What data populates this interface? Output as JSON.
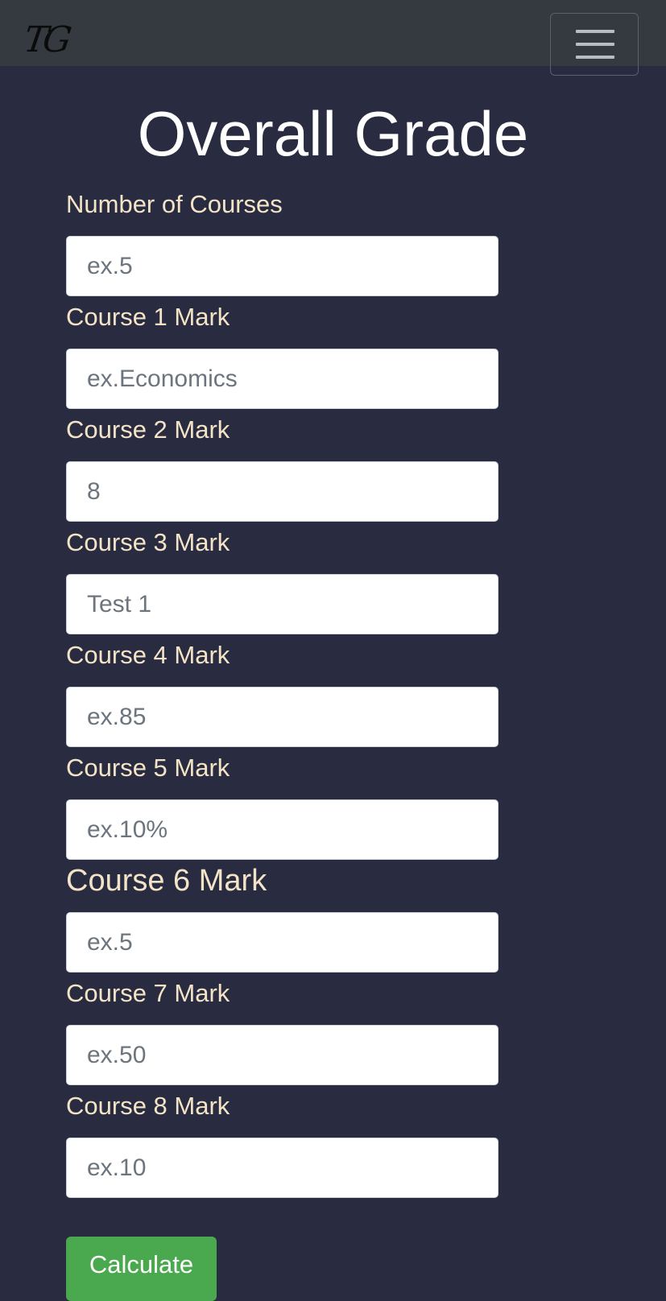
{
  "navbar": {
    "brand": "TG",
    "toggle_icon": "hamburger-menu-icon"
  },
  "page": {
    "title": "Overall Grade"
  },
  "form": {
    "fields": [
      {
        "label": "Number of Courses",
        "placeholder": "ex.5",
        "value": ""
      },
      {
        "label": "Course 1 Mark",
        "placeholder": "ex.Economics",
        "value": ""
      },
      {
        "label": "Course 2 Mark",
        "placeholder": "",
        "value": "8"
      },
      {
        "label": "Course 3 Mark",
        "placeholder": "Test 1",
        "value": ""
      },
      {
        "label": "Course 4 Mark",
        "placeholder": "ex.85",
        "value": ""
      },
      {
        "label": "Course 5 Mark",
        "placeholder": "ex.10%",
        "value": ""
      },
      {
        "label": "Course 6 Mark",
        "placeholder": "ex.5",
        "value": ""
      },
      {
        "label": "Course 7 Mark",
        "placeholder": "ex.50",
        "value": ""
      },
      {
        "label": "Course 8 Mark",
        "placeholder": "ex.10",
        "value": ""
      }
    ],
    "submit_label": "Calculate"
  },
  "colors": {
    "background": "#292b40",
    "navbar": "#343a40",
    "label": "#f3e4c7",
    "button": "#4aa84e"
  }
}
